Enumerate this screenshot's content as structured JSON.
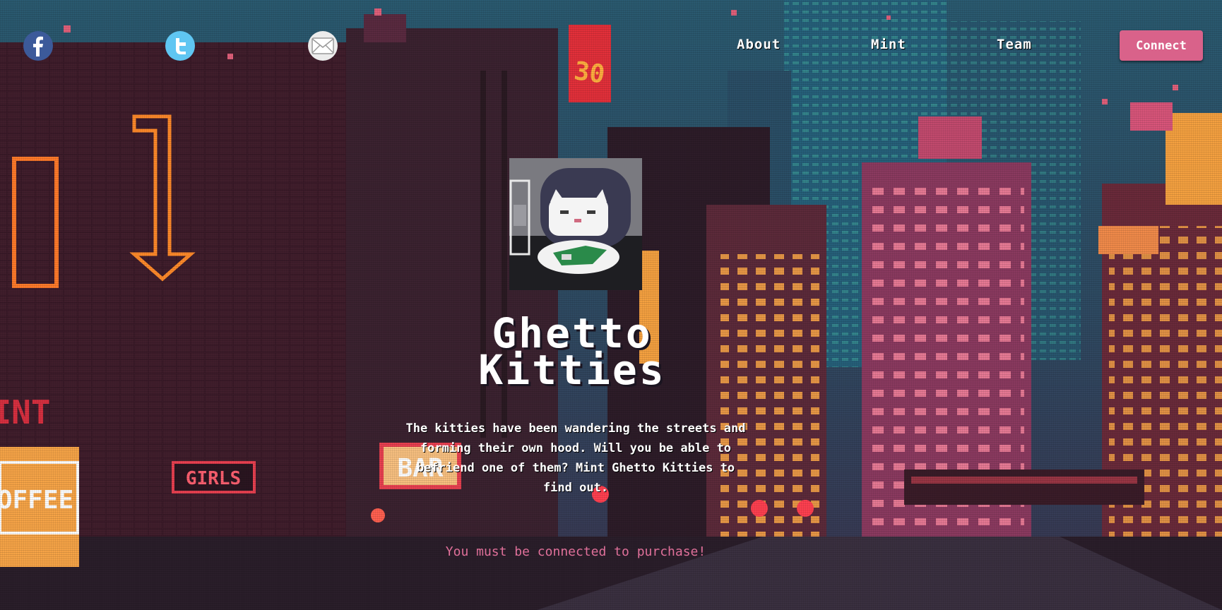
{
  "social": {
    "facebook_icon": "facebook-icon",
    "twitter_icon": "twitter-icon",
    "mail_icon": "mail-icon"
  },
  "nav": {
    "about": "About",
    "mint": "Mint",
    "team": "Team",
    "connect": "Connect"
  },
  "hero": {
    "title_line1": "Ghetto",
    "title_line2": "Kitties",
    "description": "The kitties have been wandering the streets and forming their own hood. Will you be able to befriend one of them? Mint Ghetto Kitties to find out.",
    "status": "You must be connected to purchase!"
  },
  "scene_signs": {
    "number_sign": "30",
    "bar": "BAR",
    "girls": "GIRLS",
    "coffee": "OFFEE",
    "mint": "INT"
  },
  "colors": {
    "accent": "#d9628a",
    "status_text": "#e0709a",
    "facebook": "#3c5a9a",
    "twitter": "#5fc6f2"
  }
}
